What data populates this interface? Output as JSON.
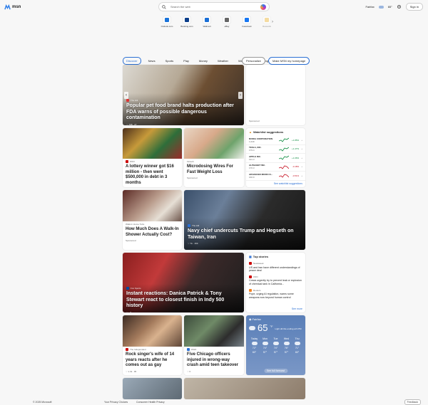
{
  "header": {
    "logo": "msn",
    "search_placeholder": "Search the web",
    "location": "Fairfax",
    "temperature": "65°",
    "signin": "Sign in"
  },
  "quick_links": [
    {
      "label": "Outlook.com",
      "color": "#1a73d9"
    },
    {
      "label": "Booking.com",
      "color": "#0b3e8a"
    },
    {
      "label": "Walmart",
      "color": "#1a6fd6"
    },
    {
      "label": "eBay",
      "color": "#666666"
    },
    {
      "label": "Facebook",
      "color": "#1877f2"
    },
    {
      "label": "Rewards",
      "color": "#f2c14b"
    }
  ],
  "nav": {
    "tabs": [
      "Discover",
      "News",
      "Sports",
      "Play",
      "Money",
      "Weather",
      "Watch",
      "Shopping"
    ],
    "personalize": "Personalize",
    "homepage": "Make MSN my homepage"
  },
  "hero": {
    "source": "The Hill",
    "caption": "Popular pet food brand halts production after FDA warns of possible dangerous contamination",
    "likes": "768",
    "comments": "27"
  },
  "ad_top": {
    "label": "Sponsored"
  },
  "lottery": {
    "source": "WKX",
    "caption": "A lottery winner got $16 million - then went $500,000 in debt in 3 months",
    "likes": "486",
    "comments": "94"
  },
  "microdosing": {
    "source": "Fintech",
    "caption": "Microdosing Wires For Fast Weight Loss",
    "sponsored": "Sponsored"
  },
  "watchlist": {
    "title": "Watchlist suggestions",
    "stocks": [
      {
        "name": "NVIDIA CORPORATION",
        "price": "1,049",
        "change": "+1.85%",
        "dir": "up"
      },
      {
        "name": "TESLA, INC.",
        "price": "179.4",
        "change": "+1.47%",
        "dir": "up"
      },
      {
        "name": "APPLE INC.",
        "price": "191.3",
        "change": "+1.06%",
        "dir": "up"
      },
      {
        "name": "ALPHABET INC.",
        "price": "176.3",
        "change": "-0.18%",
        "dir": "down"
      },
      {
        "name": "ADVANCED MICRO D...",
        "price": "166.9",
        "change": "-0.51%",
        "dir": "down"
      }
    ],
    "more": "See watchlist suggestions"
  },
  "walkin": {
    "source": "Walk-In Home Tubs",
    "caption": "How Much Does A Walk-In Shower Actually Cost?",
    "sponsored": "Sponsored"
  },
  "navy": {
    "source": "The Hill",
    "caption": "Navy chief undercuts Trump and Hegseth on Taiwan, Iran",
    "likes": "7k",
    "comments": "169"
  },
  "indy": {
    "source": "Fox Sports",
    "caption": "Instant reactions: Danica Patrick & Tony Stewart react to closest finish in Indy 500 history",
    "comments": "6"
  },
  "top_stories": {
    "title": "Top stories",
    "items": [
      {
        "source": "Newsweek",
        "text": "US and Iran have different understandings of peace deal"
      },
      {
        "source": "CNN",
        "text": "Crews urgently try to prevent leak or explosion of chemical tank in California..."
      },
      {
        "source": "Reuters",
        "text": "Pope, urging AI regulation, warns some weapons now beyond human control"
      }
    ],
    "more": "See more"
  },
  "rock": {
    "source": "The Independent",
    "caption": "Rock singer's wife of 14 years reacts after he comes out as gay",
    "likes": "1.3k",
    "comments": "95"
  },
  "chicago": {
    "source": "WGN",
    "caption": "Five Chicago officers injured in wrong-way crash amid teen takeover",
    "likes": "6"
  },
  "weather": {
    "location": "Fairfax",
    "temp": "65",
    "unit": "°F",
    "alert": "Light drizzle ending at 9 PM",
    "days": [
      {
        "day": "Today",
        "hi": "72°",
        "lo": "60°"
      },
      {
        "day": "Mon",
        "hi": "74°",
        "lo": "57°"
      },
      {
        "day": "Tue",
        "hi": "74°",
        "lo": "57°"
      },
      {
        "day": "Wed",
        "hi": "76°",
        "lo": "57°"
      },
      {
        "day": "Thu",
        "hi": "71°",
        "lo": "60°"
      }
    ],
    "more": "See full forecast"
  },
  "footer": {
    "copyright": "© 2025 Microsoft",
    "privacy": "Your Privacy Choices",
    "health": "Consumer Health Privacy",
    "feedback": "Feedback"
  },
  "colors": {
    "accent": "#2a6fd4",
    "up": "#0a8a3d",
    "down": "#c50f1f"
  }
}
